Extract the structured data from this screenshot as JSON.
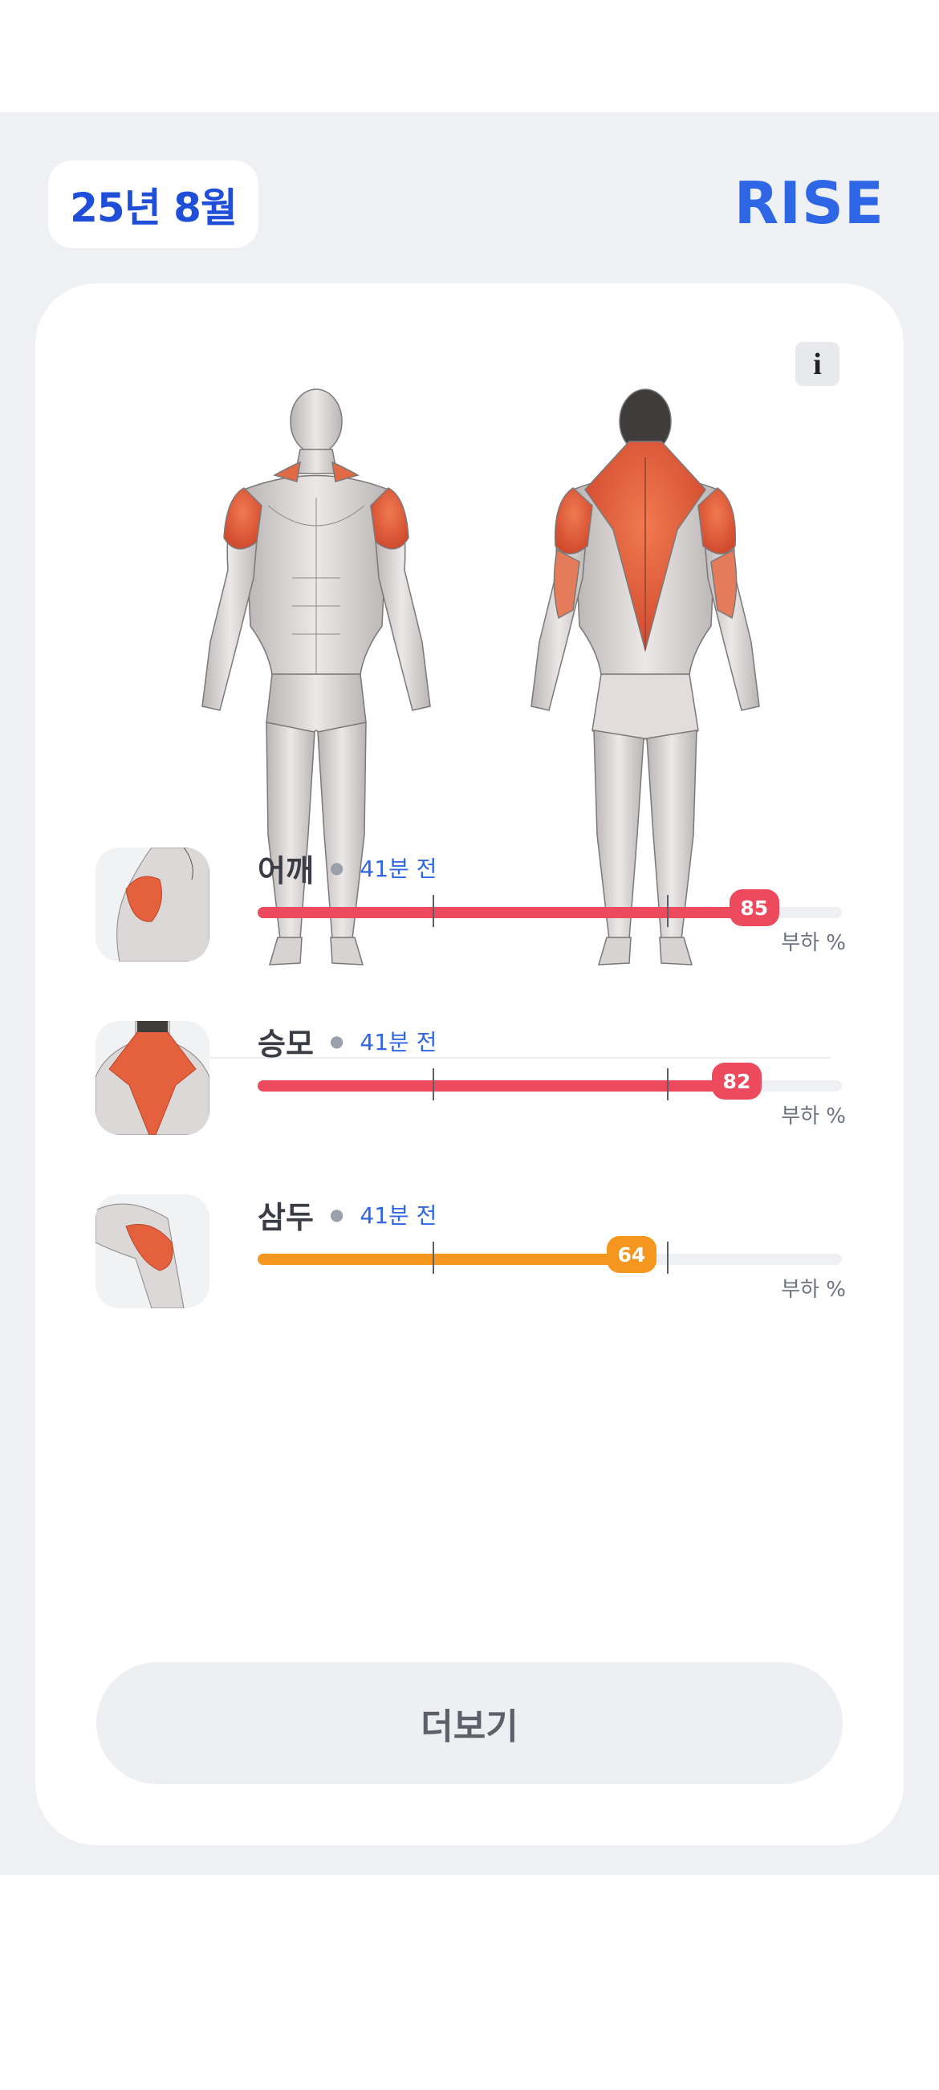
{
  "header": {
    "date_label": "25년 8월",
    "brand": "RISE"
  },
  "card": {
    "info_label": "i",
    "muscles": [
      {
        "name": "어깨",
        "time": "41분 전",
        "load_percent": 85,
        "load_label": "85",
        "unit": "부하 %",
        "color": "#ee4a5e"
      },
      {
        "name": "승모",
        "time": "41분 전",
        "load_percent": 82,
        "load_label": "82",
        "unit": "부하 %",
        "color": "#ee4a5e"
      },
      {
        "name": "삼두",
        "time": "41분 전",
        "load_percent": 64,
        "load_label": "64",
        "unit": "부하 %",
        "color": "#f5961f"
      }
    ],
    "more_button": "더보기"
  },
  "colors": {
    "brand_blue": "#2f66e6",
    "high_load": "#ee4a5e",
    "medium_load": "#f5961f",
    "muscle_active": "#e5603d"
  }
}
